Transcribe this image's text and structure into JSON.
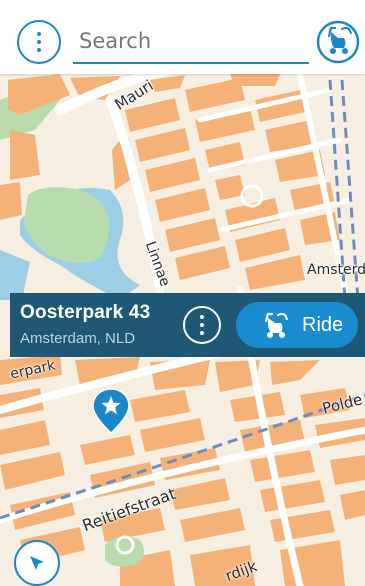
{
  "search": {
    "placeholder": "Search"
  },
  "map": {
    "street_labels": [
      "Mauri",
      "Linnae",
      "Amsterda",
      "erpark",
      "Polde",
      "Reitiefstraat",
      "rdijk"
    ],
    "colors": {
      "land": "#f6efe1",
      "blocks": "#f4b278",
      "park": "#b8dcae",
      "water": "#9ccfe6",
      "roads": "#ffffff",
      "rail": "#6c8cbf"
    }
  },
  "destination": {
    "name": "Oosterpark 43",
    "city": "Amsterdam, NLD",
    "ride_label": "Ride"
  },
  "colors": {
    "accent": "#1b87c9",
    "panel": "#1e5874",
    "ride_button": "#1b8bd0"
  },
  "icons": {
    "menu": "more-vertical-icon",
    "mode": "scooter-icon",
    "more": "more-vertical-icon",
    "ride": "scooter-icon",
    "pin": "star-pin-icon",
    "locate": "navigation-arrow-icon"
  }
}
